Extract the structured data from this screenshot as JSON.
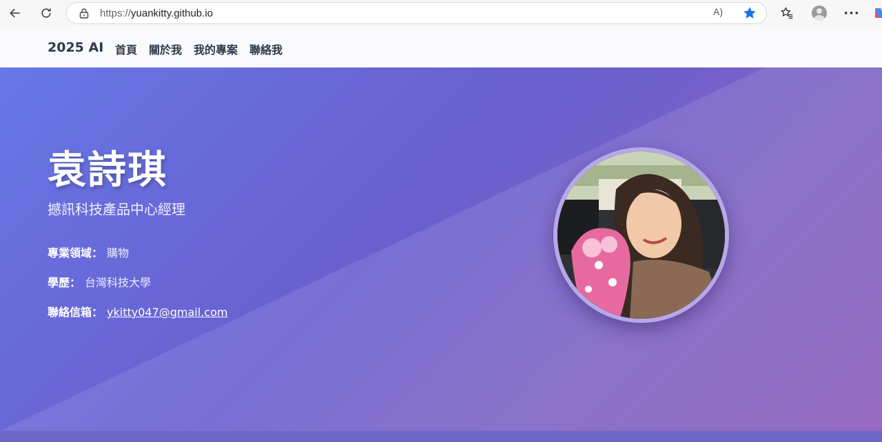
{
  "browser": {
    "url_scheme": "https://",
    "url_host": "yuankitty.github.io",
    "read_aloud_glyph": "A)",
    "more_glyph": "···"
  },
  "site": {
    "brand": "2025 AI",
    "menu": [
      "首頁",
      "關於我",
      "我的專案",
      "聯絡我"
    ]
  },
  "profile": {
    "name": "袁詩琪",
    "title": "撼訊科技產品中心經理",
    "field_label": "專業領域：",
    "field_value": "購物",
    "edu_label": "學歷：",
    "edu_value": "台灣科技大學",
    "email_label": "聯絡信箱：",
    "email_value": "ykitty047@gmail.com"
  },
  "colors": {
    "hero_start": "#6677e6",
    "hero_end": "#8a5ab8",
    "fav_star": "#1a73e8"
  }
}
